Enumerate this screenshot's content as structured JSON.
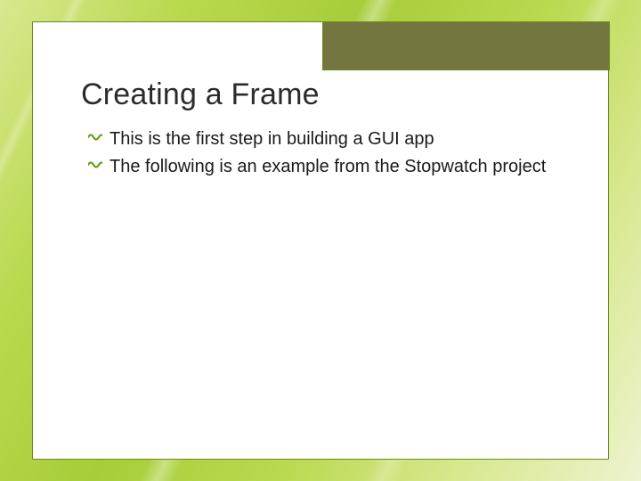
{
  "colors": {
    "accent_box": "#73773f",
    "border": "#6a8a1f",
    "bullet_icon": "#6fa01e"
  },
  "title": "Creating a Frame",
  "bullets": [
    "This is the first step in building a GUI app",
    "The following is an example from the Stopwatch project"
  ]
}
